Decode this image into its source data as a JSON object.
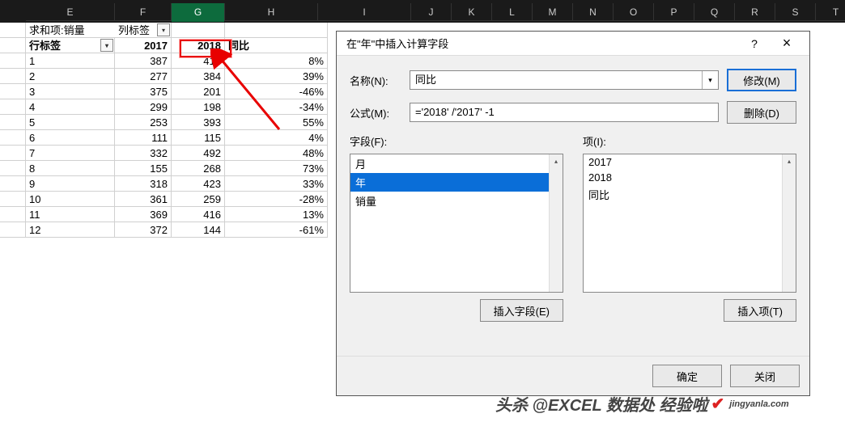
{
  "columns": [
    "E",
    "F",
    "G",
    "H",
    "I",
    "J",
    "K",
    "L",
    "M",
    "N",
    "O",
    "P",
    "Q",
    "R",
    "S",
    "T"
  ],
  "selected_column": "G",
  "pivot": {
    "corner": "求和项:销量",
    "col_label": "列标签",
    "row_label": "行标签",
    "col_headers": [
      "2017",
      "2018",
      "同比"
    ],
    "rows": [
      {
        "label": "1",
        "c17": "387",
        "c18": "418",
        "pct": "8%"
      },
      {
        "label": "2",
        "c17": "277",
        "c18": "384",
        "pct": "39%"
      },
      {
        "label": "3",
        "c17": "375",
        "c18": "201",
        "pct": "-46%"
      },
      {
        "label": "4",
        "c17": "299",
        "c18": "198",
        "pct": "-34%"
      },
      {
        "label": "5",
        "c17": "253",
        "c18": "393",
        "pct": "55%"
      },
      {
        "label": "6",
        "c17": "111",
        "c18": "115",
        "pct": "4%"
      },
      {
        "label": "7",
        "c17": "332",
        "c18": "492",
        "pct": "48%"
      },
      {
        "label": "8",
        "c17": "155",
        "c18": "268",
        "pct": "73%"
      },
      {
        "label": "9",
        "c17": "318",
        "c18": "423",
        "pct": "33%"
      },
      {
        "label": "10",
        "c17": "361",
        "c18": "259",
        "pct": "-28%"
      },
      {
        "label": "11",
        "c17": "369",
        "c18": "416",
        "pct": "13%"
      },
      {
        "label": "12",
        "c17": "372",
        "c18": "144",
        "pct": "-61%"
      }
    ]
  },
  "dialog": {
    "title": "在\"年\"中插入计算字段",
    "help": "?",
    "close": "×",
    "name_label": "名称(N):",
    "name_value": "同比",
    "formula_label": "公式(M):",
    "formula_value": "='2018' /'2017' -1",
    "modify": "修改(M)",
    "delete": "删除(D)",
    "fields_label": "字段(F):",
    "fields": [
      "月",
      "年",
      "销量"
    ],
    "selected_field": "年",
    "items_label": "项(I):",
    "items": [
      "2017",
      "2018",
      "同比"
    ],
    "insert_field": "插入字段(E)",
    "insert_item": "插入项(T)",
    "ok": "确定",
    "cancel_close": "关闭"
  },
  "watermark": {
    "text": "头杀 @EXCEL 数据处 经验啦",
    "sub": "jingyanla.com"
  }
}
